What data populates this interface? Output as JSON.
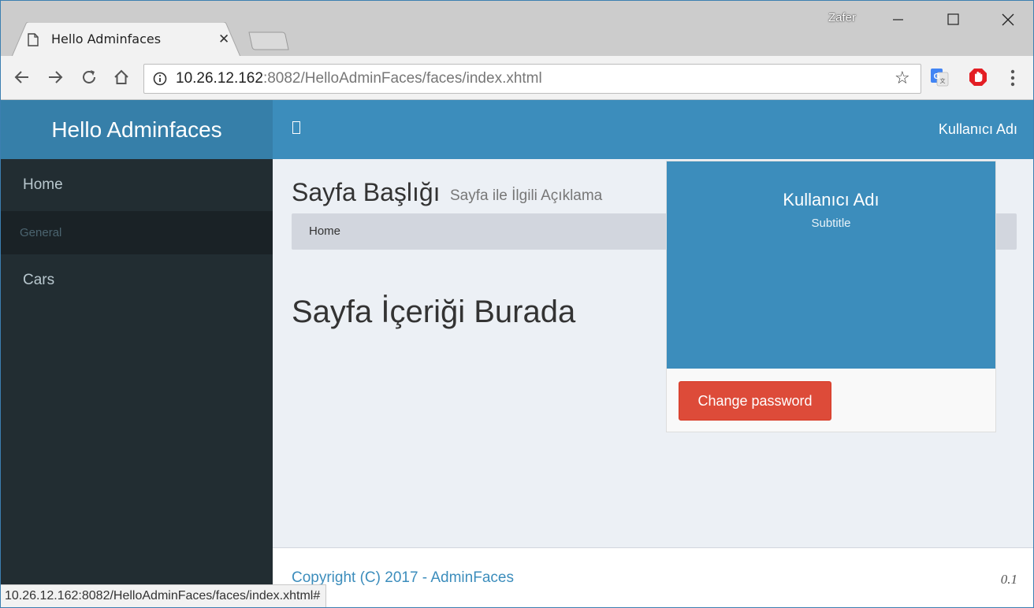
{
  "browser": {
    "tab_title": "Hello Adminfaces",
    "window_user": "Zafer",
    "url_host": "10.26.12.162",
    "url_rest": ":8082/HelloAdminFaces/faces/index.xhtml",
    "status_url": "10.26.12.162:8082/HelloAdminFaces/faces/index.xhtml#"
  },
  "app": {
    "logo": "Hello Adminfaces",
    "navbar_user": "Kullanıcı Adı"
  },
  "sidebar": {
    "items": [
      {
        "label": "Home"
      },
      {
        "label": "General"
      },
      {
        "label": "Cars"
      }
    ]
  },
  "content": {
    "title": "Sayfa Başlığı",
    "subtitle": "Sayfa ile İlgili Açıklama",
    "breadcrumb": "Home",
    "body_text": "Sayfa İçeriği Burada"
  },
  "dropdown": {
    "name": "Kullanıcı Adı",
    "subtitle": "Subtitle",
    "button": "Change password"
  },
  "footer": {
    "copyright": "Copyright (C) 2017 - AdminFaces",
    "version": "0.1"
  },
  "colors": {
    "navbar": "#3c8dbc",
    "logo": "#367fa9",
    "sidebar": "#222d32",
    "danger": "#dd4b39"
  }
}
